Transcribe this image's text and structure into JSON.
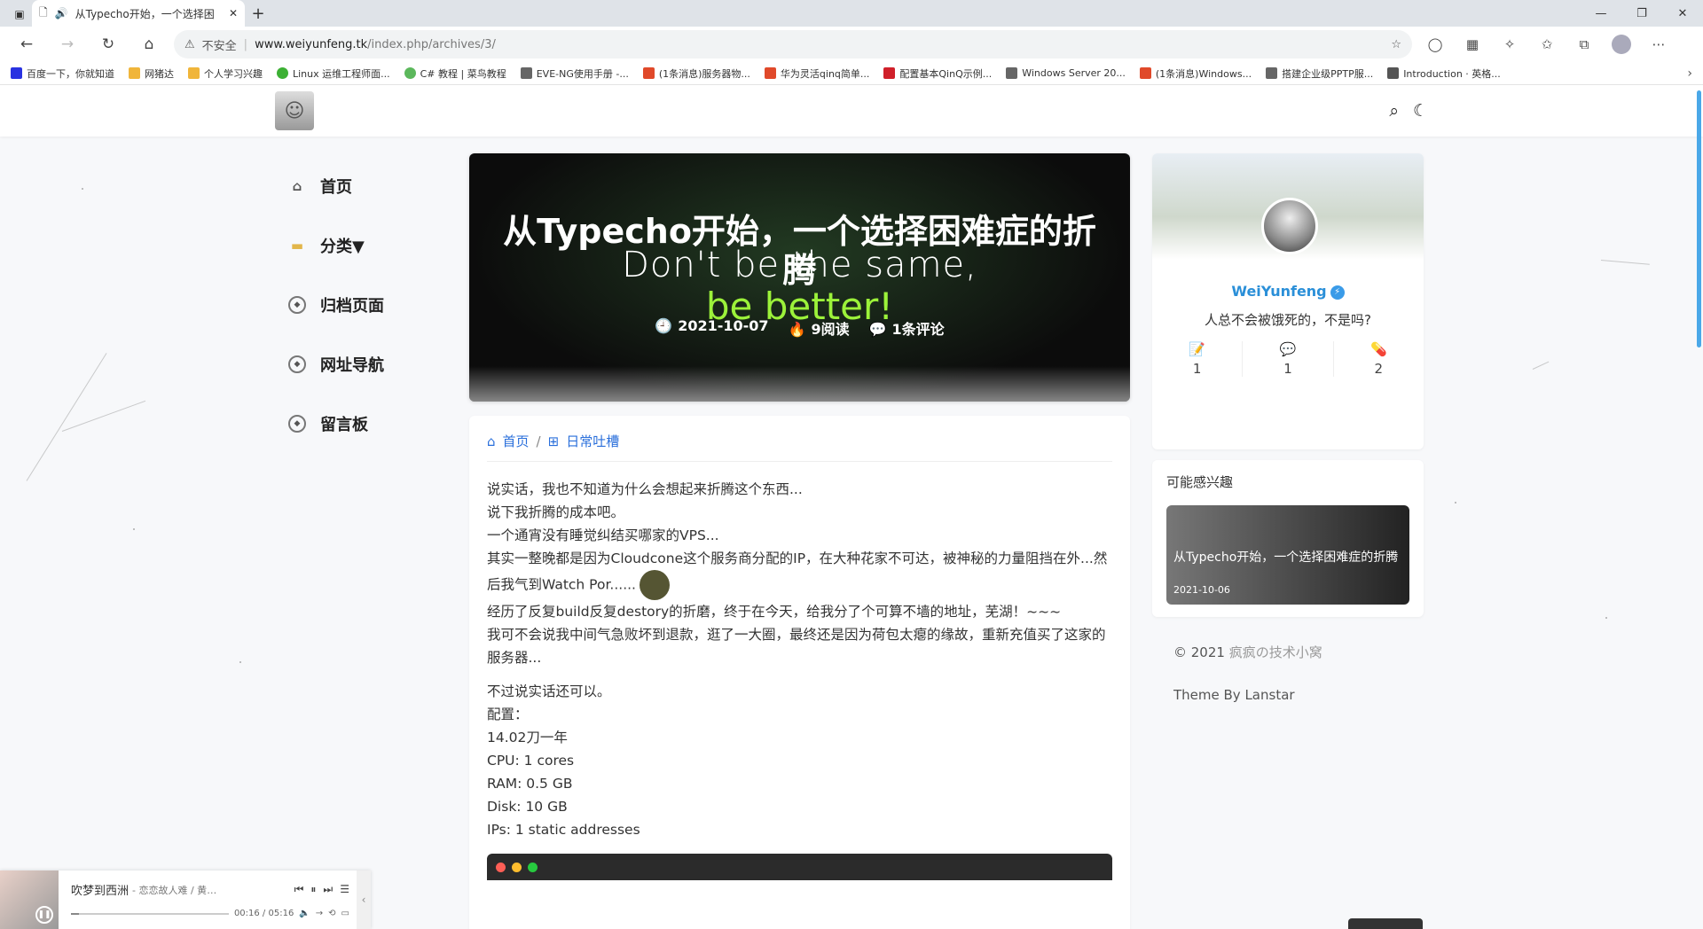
{
  "browser": {
    "tab_title": "从Typecho开始，一个选择困",
    "security_label": "不安全",
    "url_host": "www.weiyunfeng.tk",
    "url_path": "/index.php/archives/3/",
    "bookmarks": [
      {
        "label": "百度一下，你就知道",
        "color": "#2932e1"
      },
      {
        "label": "网猪达",
        "color": "#f0b53a"
      },
      {
        "label": "个人学习兴趣",
        "color": "#f0b53a"
      },
      {
        "label": "Linux 运维工程师面...",
        "color": "#3cb034"
      },
      {
        "label": "C# 教程 | 菜鸟教程",
        "color": "#5cb85c"
      },
      {
        "label": "EVE-NG使用手册 -...",
        "color": "#666666"
      },
      {
        "label": "(1条消息)服务器物...",
        "color": "#e0492a"
      },
      {
        "label": "华为灵活qinq简单...",
        "color": "#e0492a"
      },
      {
        "label": "配置基本QinQ示例...",
        "color": "#d0202a"
      },
      {
        "label": "Windows Server 20...",
        "color": "#666666"
      },
      {
        "label": "(1条消息)Windows...",
        "color": "#e0492a"
      },
      {
        "label": "搭建企业级PPTP服...",
        "color": "#666666"
      },
      {
        "label": "Introduction · 英格...",
        "color": "#555555"
      }
    ]
  },
  "nav": {
    "items": [
      {
        "label": "首页",
        "icon": "home-icon"
      },
      {
        "label": "分类▼",
        "icon": "folder-icon"
      },
      {
        "label": "归档页面",
        "icon": "compass-icon"
      },
      {
        "label": "网址导航",
        "icon": "compass-icon"
      },
      {
        "label": "留言板",
        "icon": "compass-icon"
      }
    ]
  },
  "post": {
    "title": "从Typecho开始，一个选择困难症的折腾",
    "hero_text_1": "Don't be the same,",
    "hero_text_2": "be better!",
    "date": "2021-10-07",
    "views": "9阅读",
    "comments": "1条评论",
    "breadcrumb_home": "首页",
    "breadcrumb_category": "日常吐槽",
    "paragraphs": [
      "说实话，我也不知道为什么会想起来折腾这个东西...",
      "说下我折腾的成本吧。",
      "一个通宵没有睡觉纠结买哪家的VPS...",
      "其实一整晚都是因为Cloudcone这个服务商分配的IP，在大种花家不可达，被神秘的力量阻挡在外...然后我气到Watch  Por......",
      "经历了反复build反复destory的折磨，终于在今天，给我分了个可算不墙的地址，芜湖！~~~",
      "我可不会说我中间气急败坏到退款，逛了一大圈，最终还是因为荷包太瘪的缘故，重新充值买了这家的服务器..."
    ],
    "paragraphs_2": [
      "不过说实话还可以。",
      "配置：",
      "14.02刀一年",
      "CPU:  1  cores",
      "RAM:  0.5  GB",
      "Disk:  10  GB",
      "IPs:  1  static  addresses"
    ]
  },
  "sidebar": {
    "name": "WeiYunfeng",
    "motto": "人总不会被饿死的，不是吗?",
    "stats": [
      {
        "icon": "article-icon",
        "value": "1"
      },
      {
        "icon": "comment-icon",
        "value": "1"
      },
      {
        "icon": "tag-icon",
        "value": "2"
      }
    ],
    "related_heading": "可能感兴趣",
    "related_title": "从Typecho开始，一个选择困难症的折腾",
    "related_date": "2021-10-06",
    "copyright": "© 2021",
    "site_name": "疯疯の技术小窝",
    "theme": "Theme By Lanstar"
  },
  "player": {
    "song": "吹梦到西洲",
    "artist": "- 恋恋故人难 / 黄诗扶 /...",
    "time": "00:16 / 05:16",
    "progress": 0.05
  },
  "colors": {
    "accent": "#2a6fdb",
    "profile_name": "#2a8fd8"
  }
}
